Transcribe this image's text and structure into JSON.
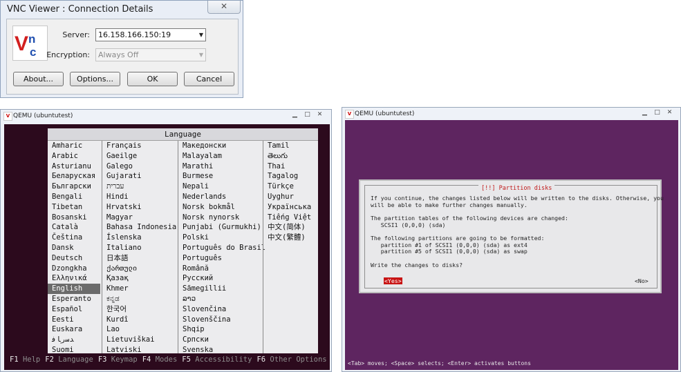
{
  "vnc": {
    "title": "VNC Viewer : Connection Details",
    "close_glyph": "✕",
    "server_label": "Server:",
    "server_value": "16.158.166.150:19",
    "encryption_label": "Encryption:",
    "encryption_value": "Always Off",
    "buttons": {
      "about": "About...",
      "options": "Options...",
      "ok": "OK",
      "cancel": "Cancel"
    }
  },
  "qemu_left": {
    "title": "QEMU (ubuntutest)",
    "language_header": "Language",
    "columns": [
      [
        "Amharic",
        "Arabic",
        "Asturianu",
        "Беларуская",
        "Български",
        "Bengali",
        "Tibetan",
        "Bosanski",
        "Català",
        "Čeština",
        "Dansk",
        "Deutsch",
        "Dzongkha",
        "Ελληνικά",
        "English",
        "Esperanto",
        "Español",
        "Eesti",
        "Euskara",
        "ﺪﺳﺭﺎﻓ",
        "Suomi"
      ],
      [
        "Français",
        "Gaeilge",
        "Galego",
        "Gujarati",
        "עברית",
        "Hindi",
        "Hrvatski",
        "Magyar",
        "Bahasa Indonesia",
        "Íslenska",
        "Italiano",
        "日本語",
        "ქართული",
        "Қазақ",
        "Khmer",
        "ಕನ್ನಡ",
        "한국어",
        "Kurdî",
        "Lao",
        "Lietuviškai",
        "Latviski"
      ],
      [
        "Македонски",
        "Malayalam",
        "Marathi",
        "Burmese",
        "Nepali",
        "Nederlands",
        "Norsk bokmål",
        "Norsk nynorsk",
        "Punjabi (Gurmukhi)",
        "Polski",
        "Português do Brasil",
        "Português",
        "Română",
        "Русский",
        "Sãmegillii",
        "ລາວ",
        "Slovenčina",
        "Slovenščina",
        "Shqip",
        "Српски",
        "Svenska"
      ],
      [
        "Tamil",
        "తెలుగు",
        "Thai",
        "Tagalog",
        "Türkçe",
        "Uyghur",
        "Українська",
        "Tiếng Việt",
        "中文(简体)",
        "中文(繁體)"
      ]
    ],
    "selected_language": "English",
    "fkeys": [
      {
        "key": "F1",
        "label": "Help"
      },
      {
        "key": "F2",
        "label": "Language"
      },
      {
        "key": "F3",
        "label": "Keymap"
      },
      {
        "key": "F4",
        "label": "Modes"
      },
      {
        "key": "F5",
        "label": "Accessibility"
      },
      {
        "key": "F6",
        "label": "Other Options"
      }
    ]
  },
  "qemu_right": {
    "title": "QEMU (ubuntutest)",
    "dialog_title": "[!!] Partition disks",
    "para1": "If you continue, the changes listed below will be written to the disks. Otherwise, you\nwill be able to make further changes manually.",
    "para2": "The partition tables of the following devices are changed:\n   SCSI1 (0,0,0) (sda)",
    "para3": "The following partitions are going to be formatted:\n   partition #1 of SCSI1 (0,0,0) (sda) as ext4\n   partition #5 of SCSI1 (0,0,0) (sda) as swap",
    "question": "Write the changes to disks?",
    "yes": "<Yes>",
    "no": "<No>",
    "hint": "<Tab> moves; <Space> selects; <Enter> activates buttons"
  },
  "colors": {
    "qemu_bg": "#2c0a1d",
    "installer_purple": "#5e2560",
    "selection_red": "#c81414"
  }
}
